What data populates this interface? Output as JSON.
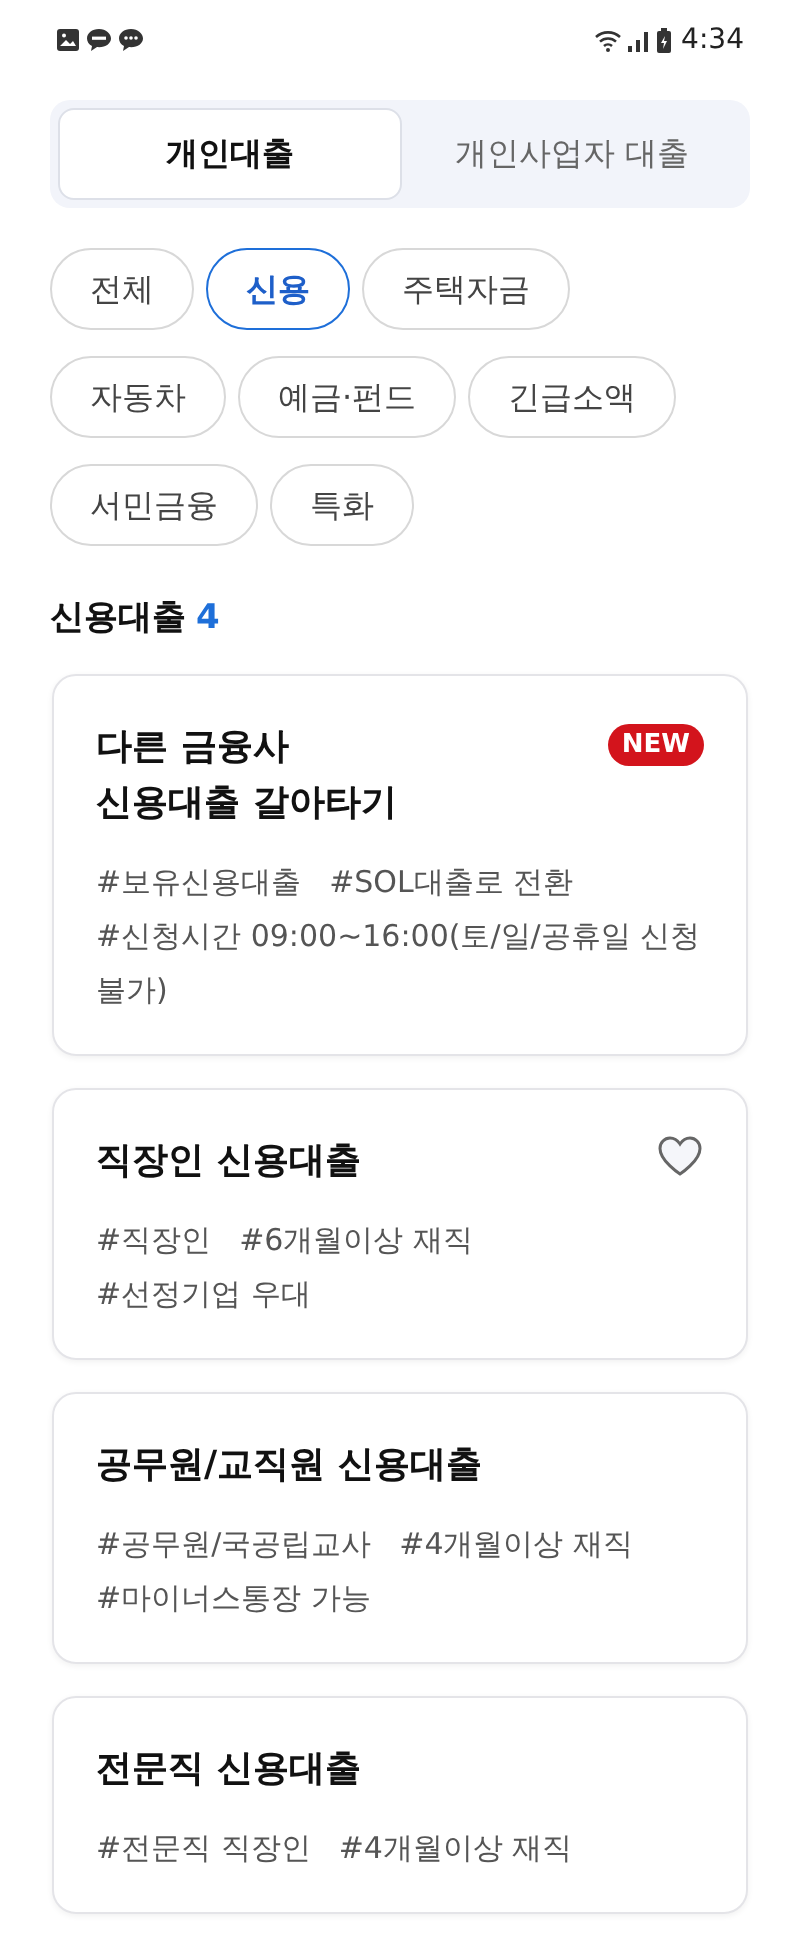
{
  "status_bar": {
    "time": "4:34"
  },
  "tabs": [
    {
      "label": "개인대출",
      "selected": true
    },
    {
      "label": "개인사업자 대출",
      "selected": false
    }
  ],
  "filters": [
    {
      "label": "전체",
      "selected": false
    },
    {
      "label": "신용",
      "selected": true
    },
    {
      "label": "주택자금",
      "selected": false
    },
    {
      "label": "자동차",
      "selected": false
    },
    {
      "label": "예금·펀드",
      "selected": false
    },
    {
      "label": "긴급소액",
      "selected": false
    },
    {
      "label": "서민금융",
      "selected": false
    },
    {
      "label": "특화",
      "selected": false
    }
  ],
  "section": {
    "title": "신용대출",
    "count": "4"
  },
  "products": [
    {
      "title_lines": [
        "다른 금융사",
        "신용대출 갈아타기"
      ],
      "badge": "NEW",
      "tags": [
        "#보유신용대출",
        "#SOL대출로 전환",
        "#신청시간 09:00~16:00(토/일/공휴일 신청불가)"
      ]
    },
    {
      "title_lines": [
        "직장인 신용대출"
      ],
      "liked": false,
      "tags": [
        "#직장인",
        "#6개월이상 재직",
        "#선정기업 우대"
      ]
    },
    {
      "title_lines": [
        "공무원/교직원 신용대출"
      ],
      "tags": [
        "#공무원/국공립교사",
        "#4개월이상 재직",
        "#마이너스통장 가능"
      ]
    },
    {
      "title_lines": [
        "전문직 신용대출"
      ],
      "tags": [
        "#전문직 직장인",
        "#4개월이상 재직"
      ]
    }
  ]
}
